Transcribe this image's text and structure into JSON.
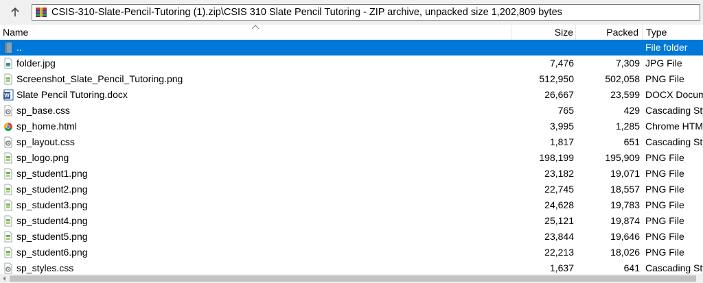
{
  "toolbar": {
    "up_label": ""
  },
  "address": {
    "path": "CSIS-310-Slate-Pencil-Tutoring (1).zip\\CSIS 310 Slate Pencil Tutoring - ZIP archive, unpacked size 1,202,809 bytes"
  },
  "columns": {
    "name": "Name",
    "size": "Size",
    "packed": "Packed",
    "type": "Type"
  },
  "files": [
    {
      "name": "..",
      "size": "",
      "packed": "",
      "type": "File folder",
      "icon": "folder-icon"
    },
    {
      "name": "folder.jpg",
      "size": "7,476",
      "packed": "7,309",
      "type": "JPG File",
      "icon": "image-file-icon"
    },
    {
      "name": "Screenshot_Slate_Pencil_Tutoring.png",
      "size": "512,950",
      "packed": "502,058",
      "type": "PNG File",
      "icon": "png-file-icon"
    },
    {
      "name": "Slate Pencil Tutoring.docx",
      "size": "26,667",
      "packed": "23,599",
      "type": "DOCX Docum",
      "icon": "word-file-icon"
    },
    {
      "name": "sp_base.css",
      "size": "765",
      "packed": "429",
      "type": "Cascading Sty",
      "icon": "css-file-icon"
    },
    {
      "name": "sp_home.html",
      "size": "3,995",
      "packed": "1,285",
      "type": "Chrome HTM",
      "icon": "chrome-html-icon"
    },
    {
      "name": "sp_layout.css",
      "size": "1,817",
      "packed": "651",
      "type": "Cascading Sty",
      "icon": "css-file-icon"
    },
    {
      "name": "sp_logo.png",
      "size": "198,199",
      "packed": "195,909",
      "type": "PNG File",
      "icon": "png-file-icon"
    },
    {
      "name": "sp_student1.png",
      "size": "23,182",
      "packed": "19,071",
      "type": "PNG File",
      "icon": "png-file-icon"
    },
    {
      "name": "sp_student2.png",
      "size": "22,745",
      "packed": "18,557",
      "type": "PNG File",
      "icon": "png-file-icon"
    },
    {
      "name": "sp_student3.png",
      "size": "24,628",
      "packed": "19,783",
      "type": "PNG File",
      "icon": "png-file-icon"
    },
    {
      "name": "sp_student4.png",
      "size": "25,121",
      "packed": "19,874",
      "type": "PNG File",
      "icon": "png-file-icon"
    },
    {
      "name": "sp_student5.png",
      "size": "23,844",
      "packed": "19,646",
      "type": "PNG File",
      "icon": "png-file-icon"
    },
    {
      "name": "sp_student6.png",
      "size": "22,213",
      "packed": "18,026",
      "type": "PNG File",
      "icon": "png-file-icon"
    },
    {
      "name": "sp_styles.css",
      "size": "1,637",
      "packed": "641",
      "type": "Cascading Sty",
      "icon": "css-file-icon"
    }
  ],
  "colors": {
    "selection": "#0078d7",
    "toolbar_bg": "#f0f0f0"
  }
}
